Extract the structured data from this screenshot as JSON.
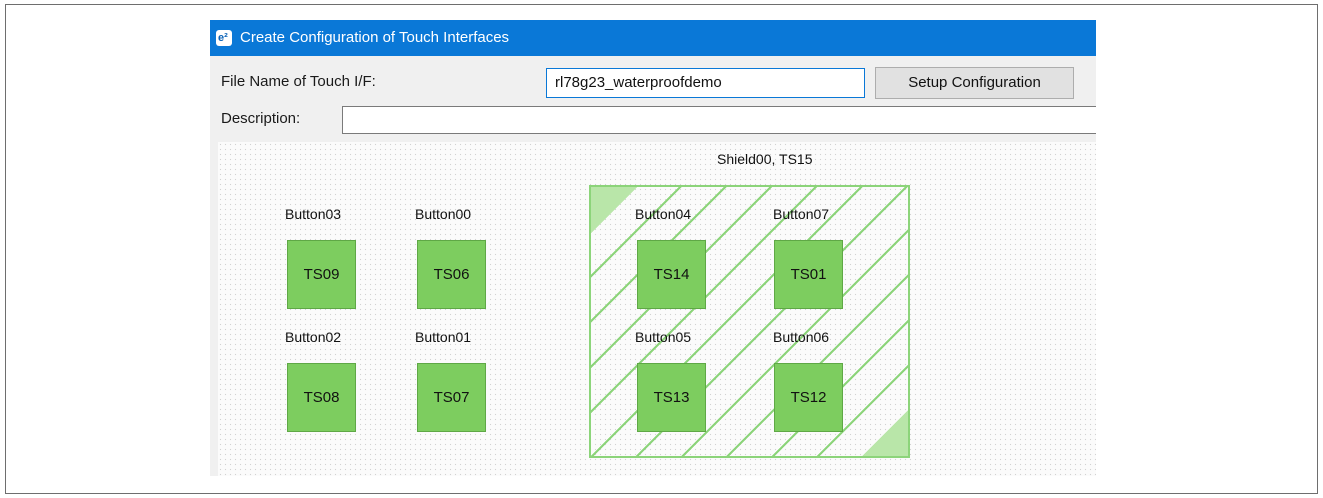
{
  "window": {
    "title": "Create Configuration of Touch Interfaces",
    "icon": "e2-studio-icon"
  },
  "form": {
    "file_label": "File Name of Touch I/F:",
    "file_value": "rl78g23_waterproofdemo",
    "setup_button": "Setup Configuration",
    "description_label": "Description:",
    "description_value": ""
  },
  "canvas": {
    "shield_label": "Shield00, TS15",
    "buttons": [
      {
        "name": "Button03",
        "ts": "TS09"
      },
      {
        "name": "Button00",
        "ts": "TS06"
      },
      {
        "name": "Button04",
        "ts": "TS14"
      },
      {
        "name": "Button07",
        "ts": "TS01"
      },
      {
        "name": "Button02",
        "ts": "TS08"
      },
      {
        "name": "Button01",
        "ts": "TS07"
      },
      {
        "name": "Button05",
        "ts": "TS13"
      },
      {
        "name": "Button06",
        "ts": "TS12"
      }
    ]
  },
  "colors": {
    "titlebar": "#0a78d7",
    "touch_key": "#7dcd5f",
    "shield": "#8cd47a"
  }
}
